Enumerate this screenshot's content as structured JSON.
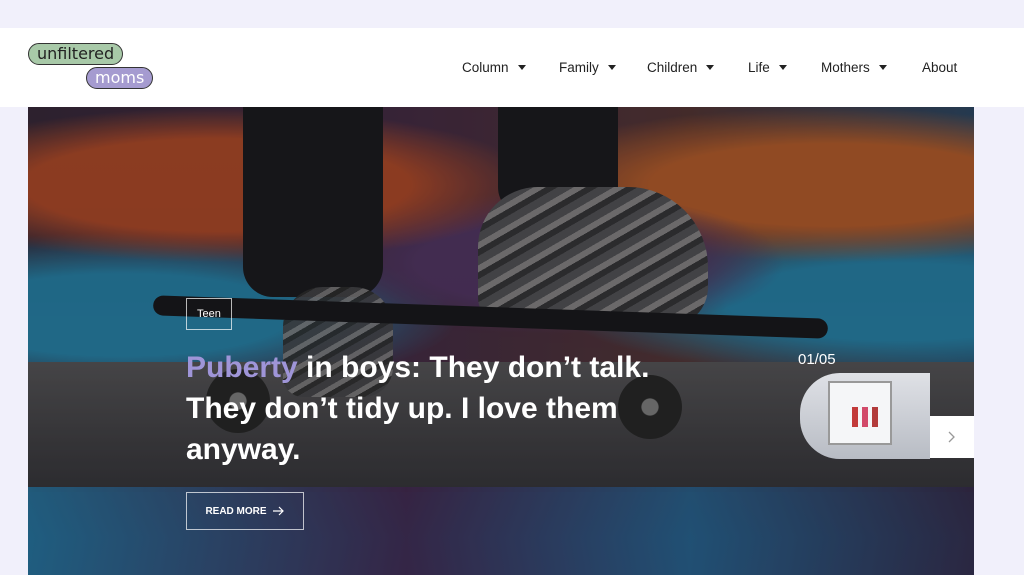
{
  "logo": {
    "line1": "unfiltered",
    "line2": "moms"
  },
  "nav": [
    {
      "label": "Column",
      "dropdown": true
    },
    {
      "label": "Family",
      "dropdown": true
    },
    {
      "label": "Children",
      "dropdown": true
    },
    {
      "label": "Life",
      "dropdown": true
    },
    {
      "label": "Mothers",
      "dropdown": true
    },
    {
      "label": "About",
      "dropdown": false
    }
  ],
  "hero": {
    "category": "Teen",
    "title_accent": "Puberty",
    "title_rest": " in boys: They don’t talk. They don’t tidy up. I love them anyway.",
    "read_more": "READ MORE",
    "slide_counter": "01/05"
  },
  "icons": {
    "read_more": "arrow-right-icon",
    "next": "chevron-right-icon"
  },
  "colors": {
    "accent": "#9f95d8",
    "logo_green": "#a8c9a8",
    "logo_purple": "#a59bd0",
    "page_bg": "#f1f0fb"
  }
}
